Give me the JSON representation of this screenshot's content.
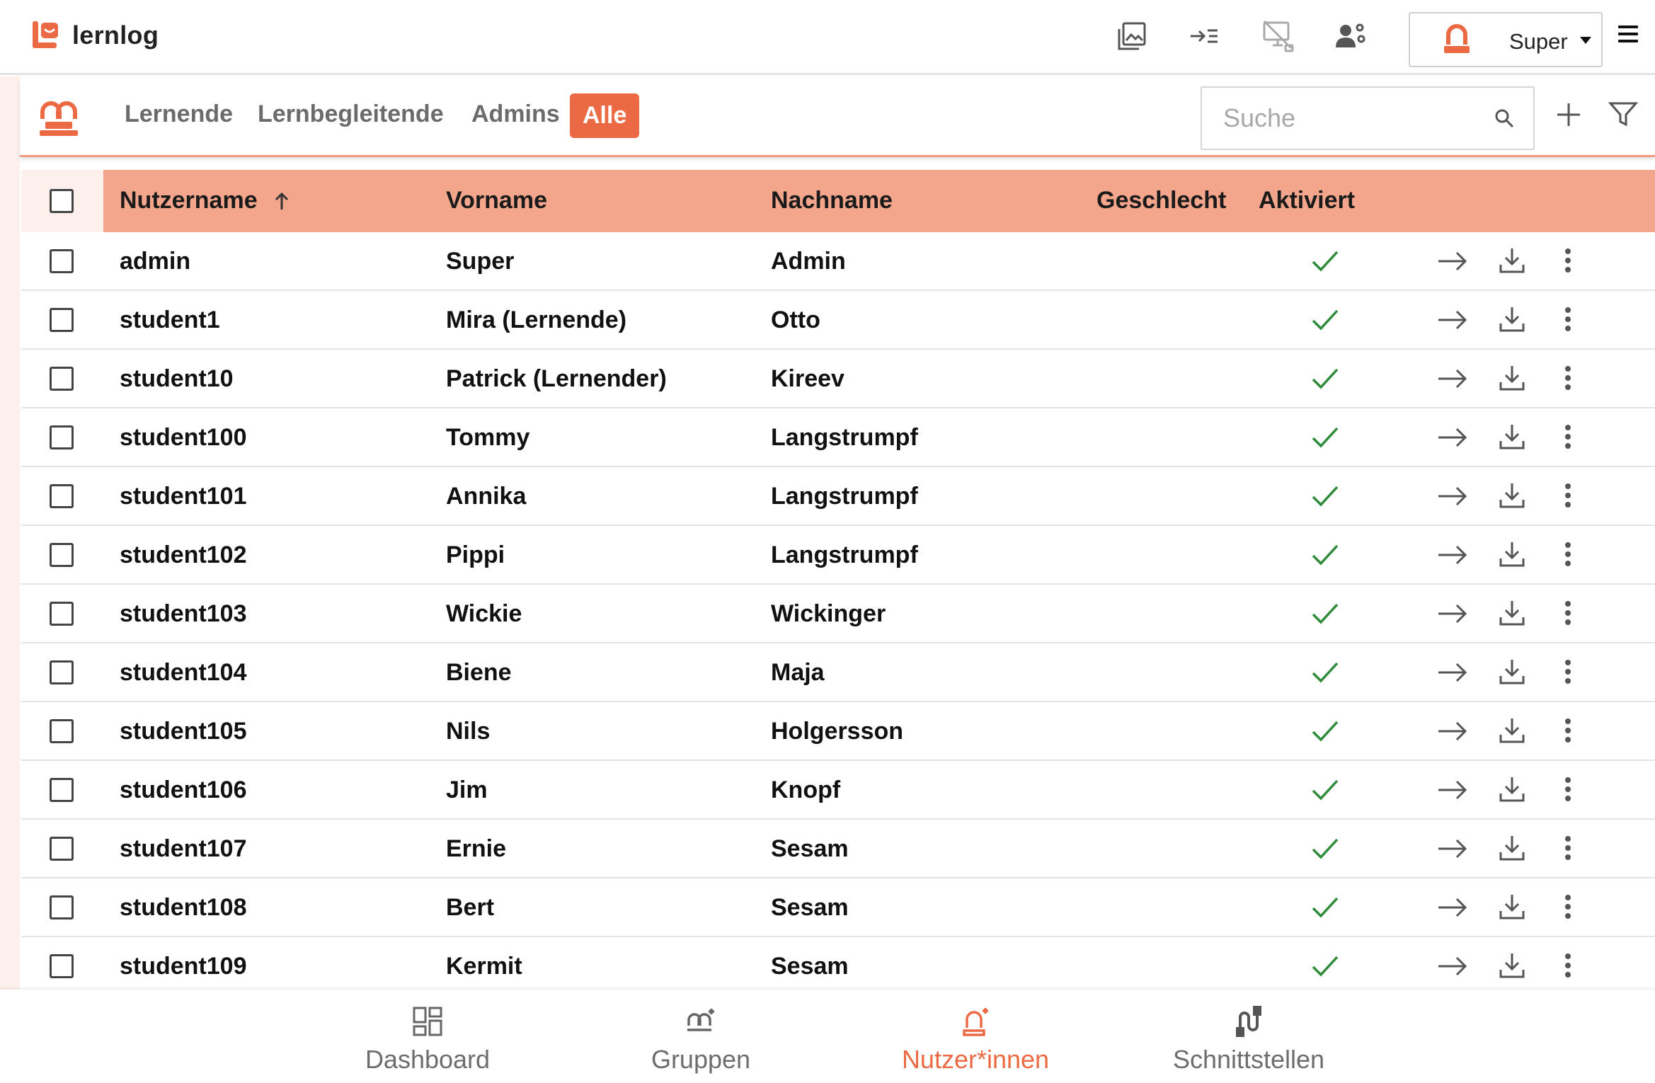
{
  "app": {
    "name": "lernlog"
  },
  "topbar": {
    "icons": [
      "gallery-icon",
      "indent-icon",
      "monitor-off-icon",
      "manage-users-icon"
    ],
    "user": {
      "name": "Super"
    }
  },
  "filter": {
    "tabs": [
      {
        "label": "Lernende"
      },
      {
        "label": "Lernbegleitende"
      },
      {
        "label": "Admins"
      },
      {
        "label": "Alle",
        "active": true
      }
    ],
    "search_placeholder": "Suche"
  },
  "table": {
    "columns": {
      "username": "Nutzername",
      "firstname": "Vorname",
      "lastname": "Nachname",
      "gender": "Geschlecht",
      "activated": "Aktiviert"
    },
    "rows": [
      {
        "username": "admin",
        "firstname": "Super",
        "lastname": "Admin",
        "gender": "",
        "activated": true
      },
      {
        "username": "student1",
        "firstname": "Mira (Lernende)",
        "lastname": "Otto",
        "gender": "",
        "activated": true
      },
      {
        "username": "student10",
        "firstname": "Patrick (Lernender)",
        "lastname": "Kireev",
        "gender": "",
        "activated": true
      },
      {
        "username": "student100",
        "firstname": "Tommy",
        "lastname": "Langstrumpf",
        "gender": "",
        "activated": true
      },
      {
        "username": "student101",
        "firstname": "Annika",
        "lastname": "Langstrumpf",
        "gender": "",
        "activated": true
      },
      {
        "username": "student102",
        "firstname": "Pippi",
        "lastname": "Langstrumpf",
        "gender": "",
        "activated": true
      },
      {
        "username": "student103",
        "firstname": "Wickie",
        "lastname": "Wickinger",
        "gender": "",
        "activated": true
      },
      {
        "username": "student104",
        "firstname": "Biene",
        "lastname": "Maja",
        "gender": "",
        "activated": true
      },
      {
        "username": "student105",
        "firstname": "Nils",
        "lastname": "Holgersson",
        "gender": "",
        "activated": true
      },
      {
        "username": "student106",
        "firstname": "Jim",
        "lastname": "Knopf",
        "gender": "",
        "activated": true
      },
      {
        "username": "student107",
        "firstname": "Ernie",
        "lastname": "Sesam",
        "gender": "",
        "activated": true
      },
      {
        "username": "student108",
        "firstname": "Bert",
        "lastname": "Sesam",
        "gender": "",
        "activated": true
      },
      {
        "username": "student109",
        "firstname": "Kermit",
        "lastname": "Sesam",
        "gender": "",
        "activated": true
      }
    ]
  },
  "bottomnav": {
    "items": [
      {
        "label": "Dashboard",
        "icon": "dashboard-icon"
      },
      {
        "label": "Gruppen",
        "icon": "groups-icon"
      },
      {
        "label": "Nutzer*innen",
        "icon": "users-icon",
        "active": true
      },
      {
        "label": "Schnittstellen",
        "icon": "interfaces-icon"
      }
    ]
  },
  "colors": {
    "accent": "#ec6a43",
    "header_row": "#f4a68c",
    "check_green": "#2e8b3a"
  }
}
